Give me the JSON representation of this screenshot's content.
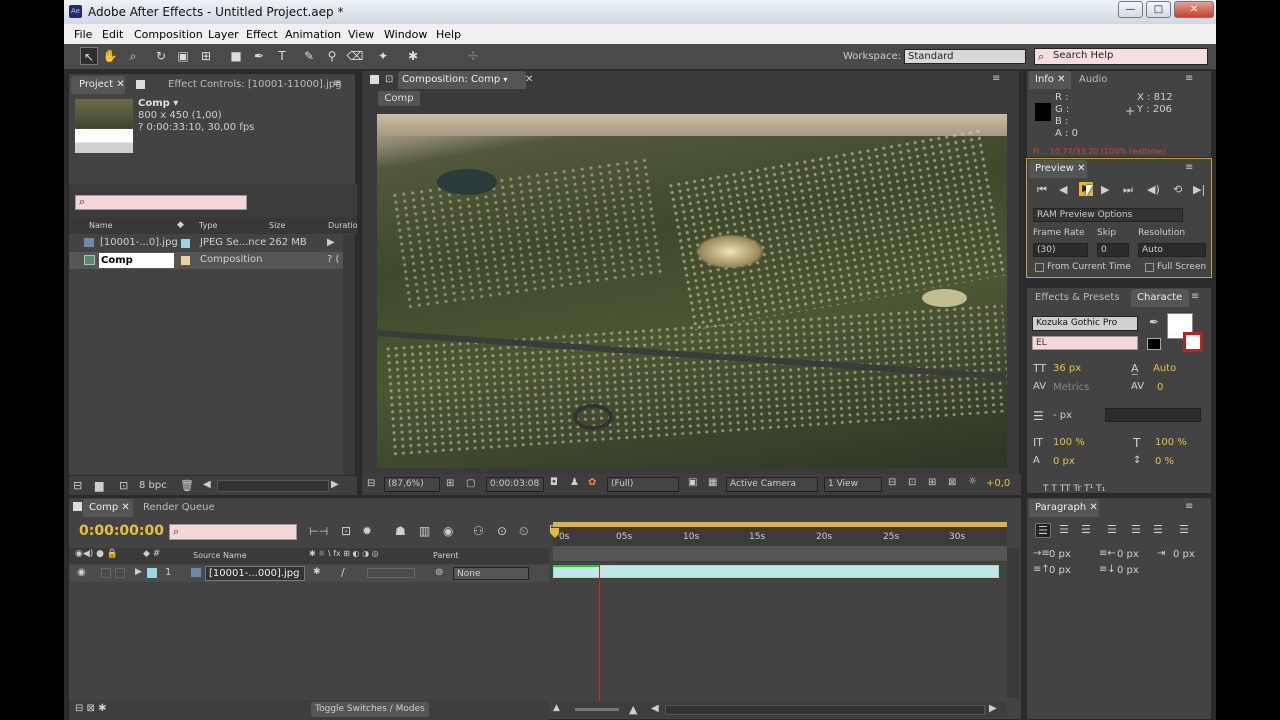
{
  "window": {
    "title": "Adobe After Effects - Untitled Project.aep *",
    "minimize": "—",
    "maximize": "□",
    "close": "✕"
  },
  "menu": [
    "File",
    "Edit",
    "Composition",
    "Layer",
    "Effect",
    "Animation",
    "View",
    "Window",
    "Help"
  ],
  "workspace": {
    "label": "Workspace:",
    "value": "Standard"
  },
  "search_help": "Search Help",
  "project": {
    "tab_project": "Project",
    "tab_effect_controls": "Effect Controls: [10001-11000].jpg",
    "item_name": "Comp ▾",
    "item_size": "800 x 450 (1,00)",
    "item_duration": "? 0:00:33:10, 30,00 fps",
    "columns": {
      "name": "Name",
      "type": "Type",
      "size": "Size",
      "duration": "Duratio"
    },
    "rows": [
      {
        "name": "[10001-...0].jpg",
        "type": "JPEG Se...nce",
        "size": "262 MB",
        "dur": "▶"
      },
      {
        "name": "Comp",
        "type": "Composition",
        "size": "",
        "dur": "? ("
      }
    ],
    "bpc": "8 bpc"
  },
  "composition": {
    "tab": "Composition: Comp",
    "comp_label": "Comp",
    "zoom": "(87,6%)",
    "timecode": "0:00:03:08",
    "resolution": "(Full)",
    "camera": "Active Camera",
    "views": "1 View",
    "offset": "+0,0"
  },
  "info": {
    "tab_info": "Info",
    "tab_audio": "Audio",
    "r": "R :",
    "g": "G :",
    "b": "B :",
    "a": "A : 0",
    "x": "X : 812",
    "y": "Y : 206",
    "clipped": "Fr... 10,77/33,20 (100% realtime)"
  },
  "preview": {
    "tab": "Preview",
    "options": "RAM Preview Options",
    "frame_rate_label": "Frame Rate",
    "frame_rate": "(30)",
    "skip_label": "Skip",
    "skip": "0",
    "resolution_label": "Resolution",
    "resolution": "Auto",
    "from_current": "From Current Time",
    "full_screen": "Full Screen"
  },
  "character": {
    "tab_effects": "Effects & Presets",
    "tab_character": "Characte",
    "font": "Kozuka Gothic Pro",
    "style": "EL",
    "size": "36 px",
    "leading": "Auto",
    "kerning": "Metrics",
    "tracking": "0",
    "stroke": "- px",
    "vscale": "100 %",
    "hscale": "100 %",
    "baseline": "0 px",
    "tsume": "0 %",
    "tt": "T T TT Tr T¹ T₁"
  },
  "paragraph": {
    "tab": "Paragraph",
    "indent1": "0 px",
    "indent2": "0 px",
    "indent3": "0 px",
    "space1": "0 px",
    "space2": "0 px"
  },
  "timeline": {
    "tab_comp": "Comp",
    "tab_render": "Render Queue",
    "timecode": "0:00:00:00",
    "ruler": [
      "0s",
      "05s",
      "10s",
      "15s",
      "20s",
      "25s",
      "30s"
    ],
    "col_source": "Source Name",
    "col_parent": "Parent",
    "layer": {
      "index": "1",
      "name": "[10001-...000].jpg",
      "parent": "None"
    },
    "toggle": "Toggle Switches / Modes"
  }
}
